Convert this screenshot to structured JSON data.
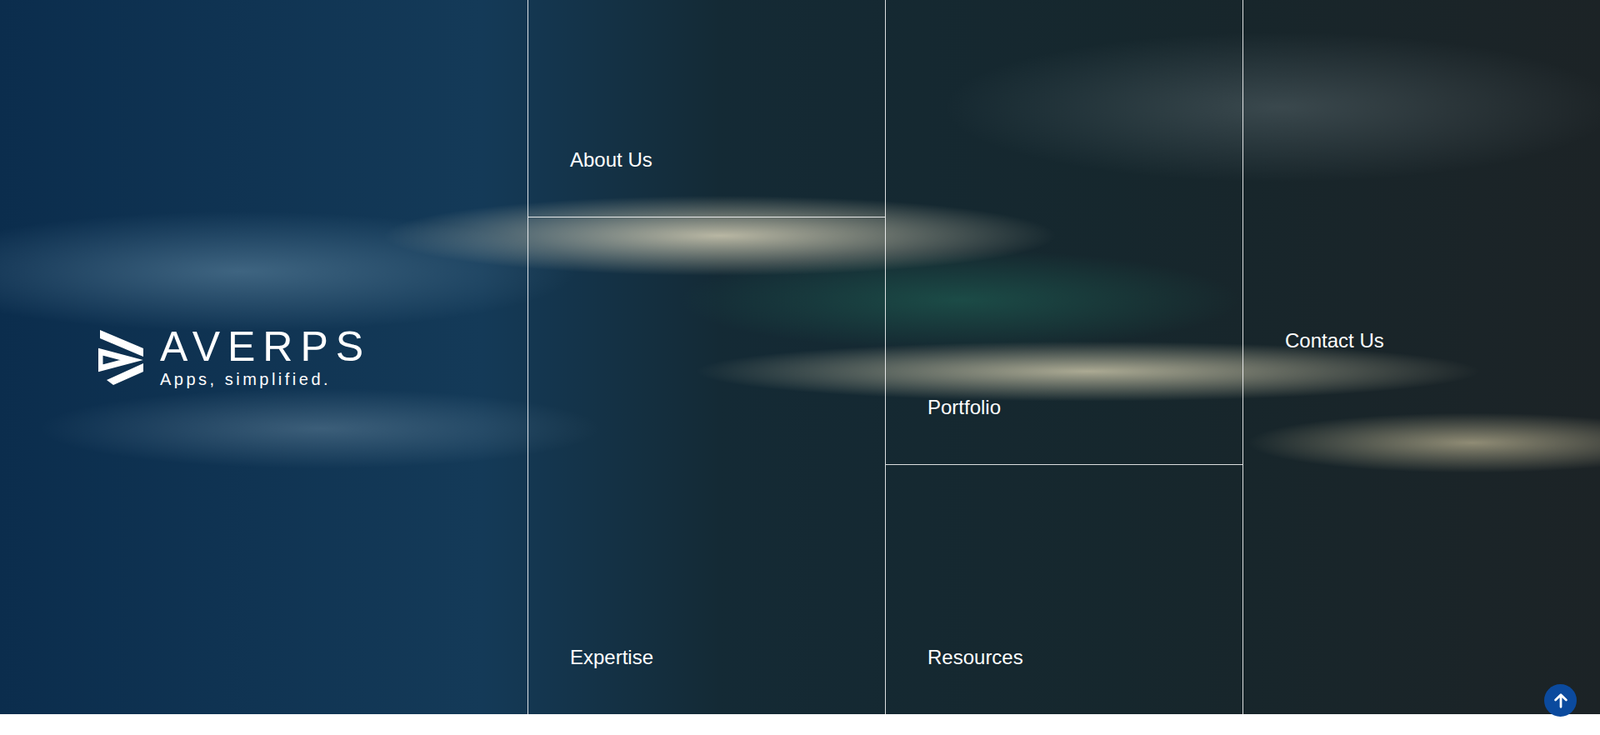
{
  "logo": {
    "name": "AVERPS",
    "tagline": "Apps, simplified."
  },
  "nav": {
    "columns": [
      {
        "tiles": [
          {
            "label": "About Us"
          },
          {
            "label": "Expertise"
          }
        ]
      },
      {
        "tiles": [
          {
            "label": "Portfolio"
          },
          {
            "label": "Resources"
          }
        ]
      },
      {
        "tiles": [
          {
            "label": "Contact Us"
          }
        ]
      }
    ]
  }
}
